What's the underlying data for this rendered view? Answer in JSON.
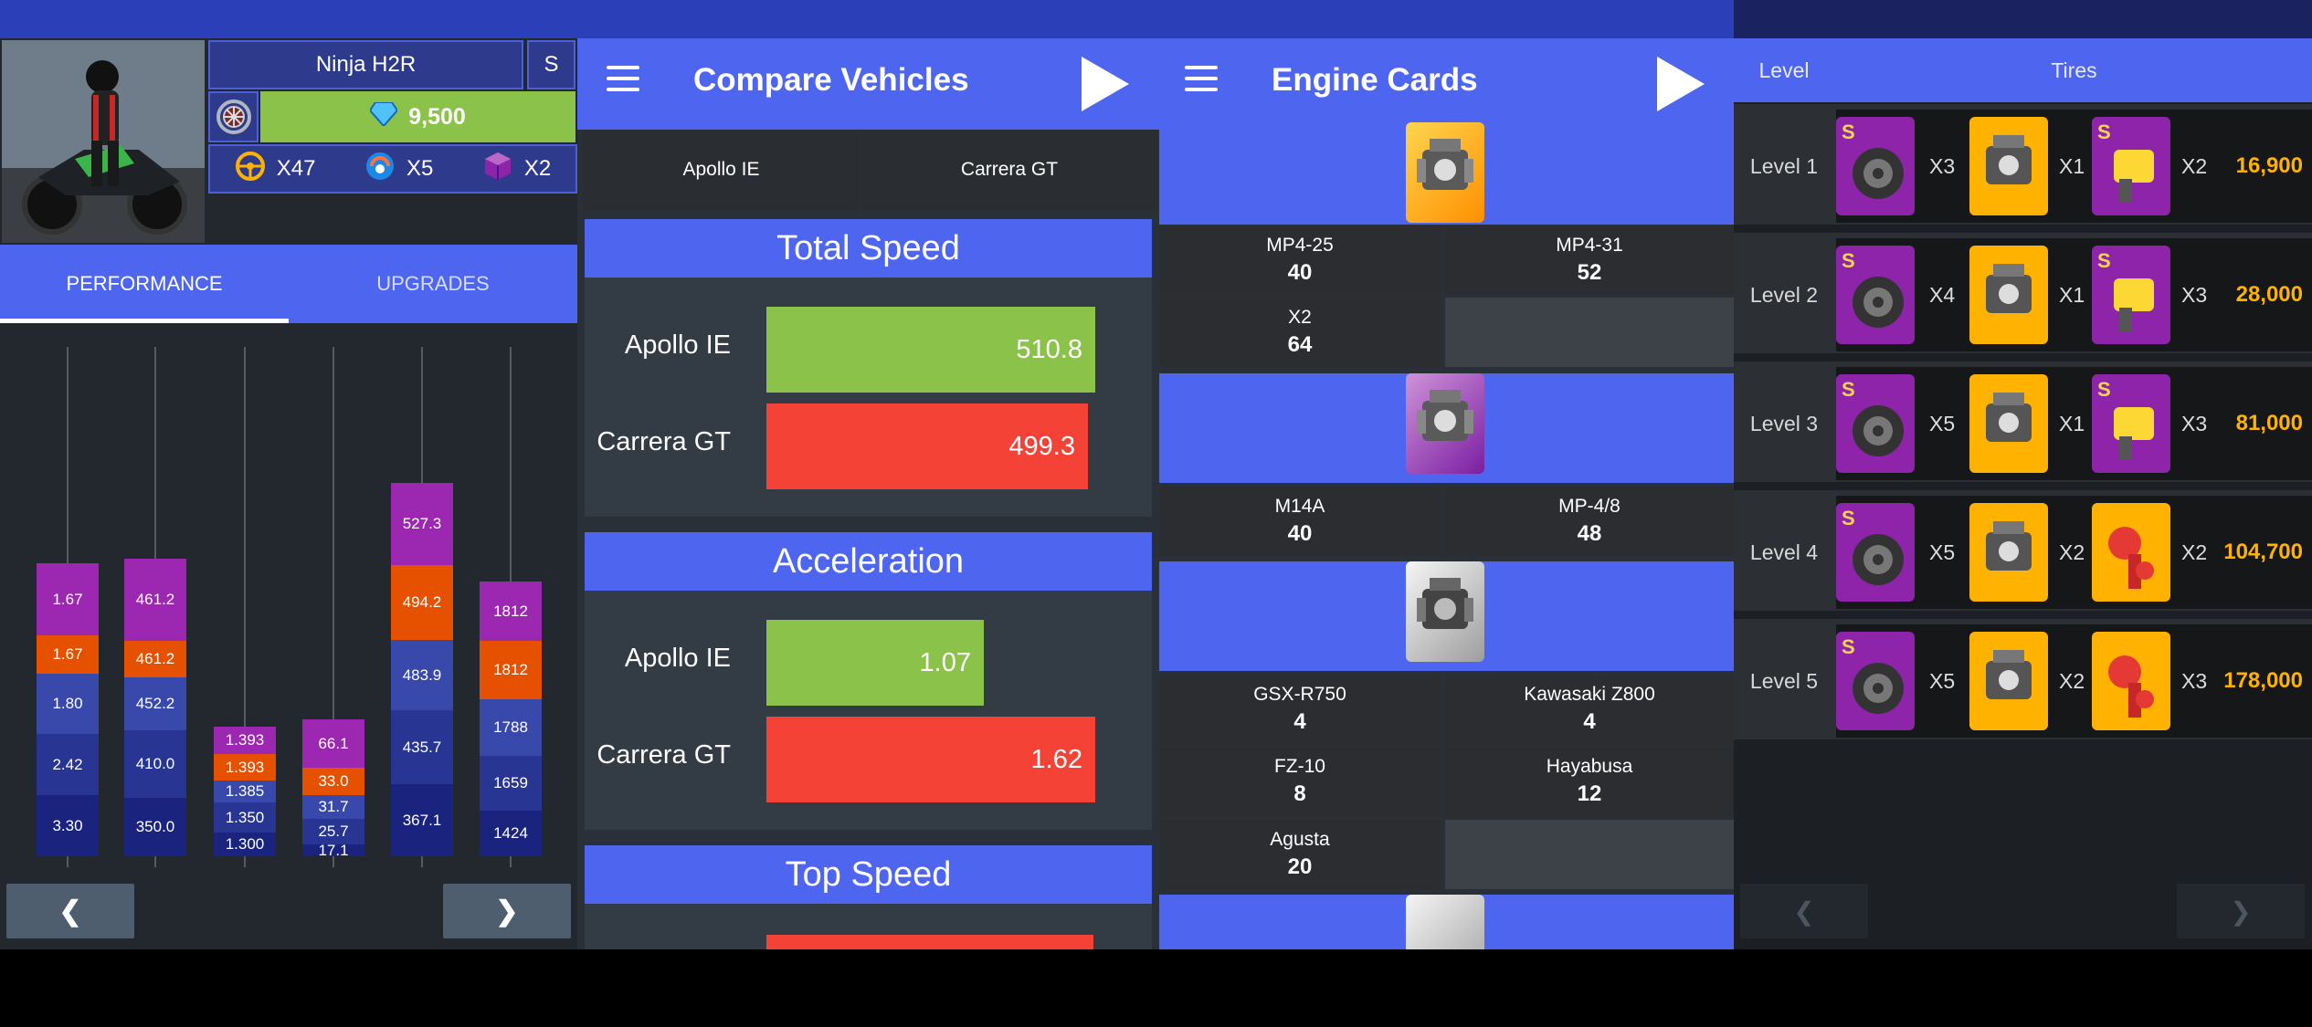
{
  "panel1": {
    "bike_name": "Ninja H2R",
    "bike_class": "S",
    "cost": "9,500",
    "resources": [
      {
        "icon": "steering-wheel-icon",
        "count": "X47"
      },
      {
        "icon": "blue-token-icon",
        "count": "X5"
      },
      {
        "icon": "purple-cube-icon",
        "count": "X2"
      }
    ],
    "tabs": [
      "PERFORMANCE",
      "UPGRADES"
    ],
    "stacks": [
      [
        "3.30",
        "2.42",
        "1.80",
        "1.67",
        "1.67"
      ],
      [
        "350.0",
        "410.0",
        "452.2",
        "461.2",
        "461.2"
      ],
      [
        "1.300",
        "1.350",
        "1.385",
        "1.393",
        "1.393"
      ],
      [
        "17.1",
        "25.7",
        "31.7",
        "33.0",
        "66.1"
      ],
      [
        "367.1",
        "435.7",
        "483.9",
        "494.2",
        "527.3"
      ],
      [
        "1424",
        "1659",
        "1788",
        "1812",
        "1812"
      ]
    ],
    "stack_colors": [
      "#1a237e",
      "#283593",
      "#3949ab",
      "#e65100",
      "#9c27b0"
    ],
    "prev": "❮",
    "next": "❯"
  },
  "panel2": {
    "title": "Compare Vehicles",
    "vehicles": [
      "Apollo IE",
      "Carrera GT"
    ],
    "sections": [
      {
        "title": "Total Speed",
        "rows": [
          {
            "name": "Apollo IE",
            "value": "510.8",
            "color": "#8bc34a",
            "fraction": 1.0
          },
          {
            "name": "Carrera GT",
            "value": "499.3",
            "color": "#f44336",
            "fraction": 0.977
          }
        ]
      },
      {
        "title": "Acceleration",
        "rows": [
          {
            "name": "Apollo IE",
            "value": "1.07",
            "color": "#8bc34a",
            "fraction": 0.66
          },
          {
            "name": "Carrera GT",
            "value": "1.62",
            "color": "#f44336",
            "fraction": 1.0
          }
        ]
      },
      {
        "title": "Top Speed"
      }
    ]
  },
  "panel3": {
    "title": "Engine Cards",
    "groups": [
      {
        "cells": [
          {
            "name": "MP4-25",
            "value": "40"
          },
          {
            "name": "MP4-31",
            "value": "52"
          },
          {
            "name": "X2",
            "value": "64"
          }
        ]
      },
      {
        "cells": [
          {
            "name": "M14A",
            "value": "40"
          },
          {
            "name": "MP-4/8",
            "value": "48"
          }
        ]
      },
      {
        "cells": [
          {
            "name": "GSX-R750",
            "value": "4"
          },
          {
            "name": "Kawasaki Z800",
            "value": "4"
          },
          {
            "name": "FZ-10",
            "value": "8"
          },
          {
            "name": "Hayabusa",
            "value": "12"
          },
          {
            "name": "Agusta",
            "value": "20"
          }
        ]
      }
    ]
  },
  "panel4": {
    "col_level": "Level",
    "col_tires": "Tires",
    "levels": [
      {
        "label": "Level 1",
        "q1": "X3",
        "q2": "X1",
        "q3": "X2",
        "price": "16,900",
        "third": "yellow"
      },
      {
        "label": "Level 2",
        "q1": "X4",
        "q2": "X1",
        "q3": "X3",
        "price": "28,000",
        "third": "yellow"
      },
      {
        "label": "Level 3",
        "q1": "X5",
        "q2": "X1",
        "q3": "X3",
        "price": "81,000",
        "third": "yellow"
      },
      {
        "label": "Level 4",
        "q1": "X5",
        "q2": "X2",
        "q3": "X2",
        "price": "104,700",
        "third": "red"
      },
      {
        "label": "Level 5",
        "q1": "X5",
        "q2": "X2",
        "q3": "X3",
        "price": "178,000",
        "third": "red"
      }
    ],
    "prev": "❮",
    "next": "❯"
  }
}
